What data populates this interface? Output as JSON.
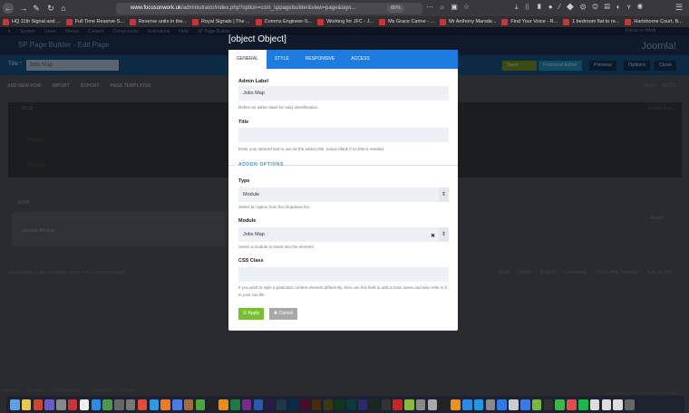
{
  "browser": {
    "url_domain": "www.focusonwork.uk",
    "url_rest": "/administrator/index.php?option=com_sppagebuilder&view=page&layo...",
    "zoom": "80%",
    "bookmarks": [
      "HQ 11th Signal and ...",
      "Full Time Reserve S...",
      "Reserve units in the...",
      "Royal Signals | The ...",
      "Comms Engineer-S...",
      "Working for JFC - J...",
      "Ms Grace Carine - ...",
      "Mr Anthony Marsde...",
      "Find Your Voice - R...",
      "1 bedroom flat to re...",
      "Hartshorne Court, B..."
    ]
  },
  "joomla": {
    "menu": [
      "System",
      "Users",
      "Menus",
      "Content",
      "Components",
      "Extensions",
      "Help",
      "SP Page Builder"
    ],
    "site_link": "Focus on Work",
    "header_title": "SP Page Builder - Edit Page",
    "logo": "Joomla!",
    "title_label": "Title *",
    "title_value": "Jobs Map",
    "buttons": {
      "save": "Save",
      "frontend": "Frontend Editor",
      "preview": "Preview",
      "options": "Options",
      "close": "Close"
    },
    "toolbar": [
      "ADD NEW ROW",
      "IMPORT",
      "EXPORT",
      "PAGE TEMPLATES"
    ],
    "undo": "UNDO",
    "redo": "REDO",
    "row1": {
      "label": "ROW",
      "enable": "Enable Row",
      "items": [
        "Heading",
        "Heading"
      ]
    },
    "row2": {
      "label": "ROW",
      "addon": "Addon",
      "module_name": "Joomla Module",
      "module_sub": "Jobs Map"
    },
    "footer": "DESIGNED & DEVELOPED WITH ♥ BY JOOMSHAPER",
    "footer_links": [
      "Guide",
      "Videos",
      "Support",
      "Community",
      "Find & Help Translate",
      "Rate on JED"
    ],
    "status": [
      "View Site",
      "0 Visitors",
      "1 Administrator",
      "0 Messages",
      "Log out"
    ],
    "version": "Joomla! 3.7.3 — © 2018 Focus on Work"
  },
  "modal": {
    "title": {
      "label": "Title",
      "value": "",
      "help": "Enter your desired text to use as the addon title. Leave blank if no title is needed."
    },
    "tabs": [
      "GENERAL",
      "STYLE",
      "RESPONSIVE",
      "ACCESS"
    ],
    "admin_label": {
      "label": "Admin Label",
      "value": "Jobs Map",
      "help": "Define an admin label for easy identification."
    },
    "section": "ADDON OPTIONS",
    "type": {
      "label": "Type",
      "value": "Module",
      "help": "Select an option from the dropdown list."
    },
    "module": {
      "label": "Module",
      "value": "Jobs Map",
      "help": "Select a module to insert into the element."
    },
    "css_class": {
      "label": "CSS Class",
      "value": "",
      "help": "If you wish to style a particular content element differently, then use this field to add a class name and also refer to it in your css file."
    },
    "apply": "Apply",
    "cancel": "Cancel"
  },
  "dock_colors": [
    "#5aa0e8",
    "#e8c84a",
    "#d0452f",
    "#6a5ad0",
    "#888",
    "#c33",
    "#eee",
    "#2a8ae8",
    "#4a9a4a",
    "#666",
    "#777",
    "#e84a3a",
    "#2a9ae8",
    "#f07a20",
    "#4a7ae8",
    "#a86a3a",
    "#4aa83a",
    "#222",
    "#f08a10",
    "#1e7a40",
    "#7a2a8a",
    "#2a5ab0",
    "#2a1a4a",
    "#1a3a4a",
    "#0a2a4a",
    "#4a0a2a",
    "#4a2a0a",
    "#3a3a0a",
    "#0a3a1a",
    "#0a3a3a",
    "#2a2a6a",
    "#1a2a1a",
    "#333",
    "#c22",
    "#8aba3a",
    "#888",
    "#aaa",
    "#222",
    "#f0901a",
    "#2a8ae8",
    "#1a9ae8",
    "#888",
    "#2a7ae8",
    "#ccc",
    "#3a7ae8",
    "#7ab83a",
    "#333",
    "#3ab84a",
    "#e84a4a",
    "#1ab84a",
    "#ddd",
    "#ddd",
    "#ddd",
    "#666"
  ]
}
